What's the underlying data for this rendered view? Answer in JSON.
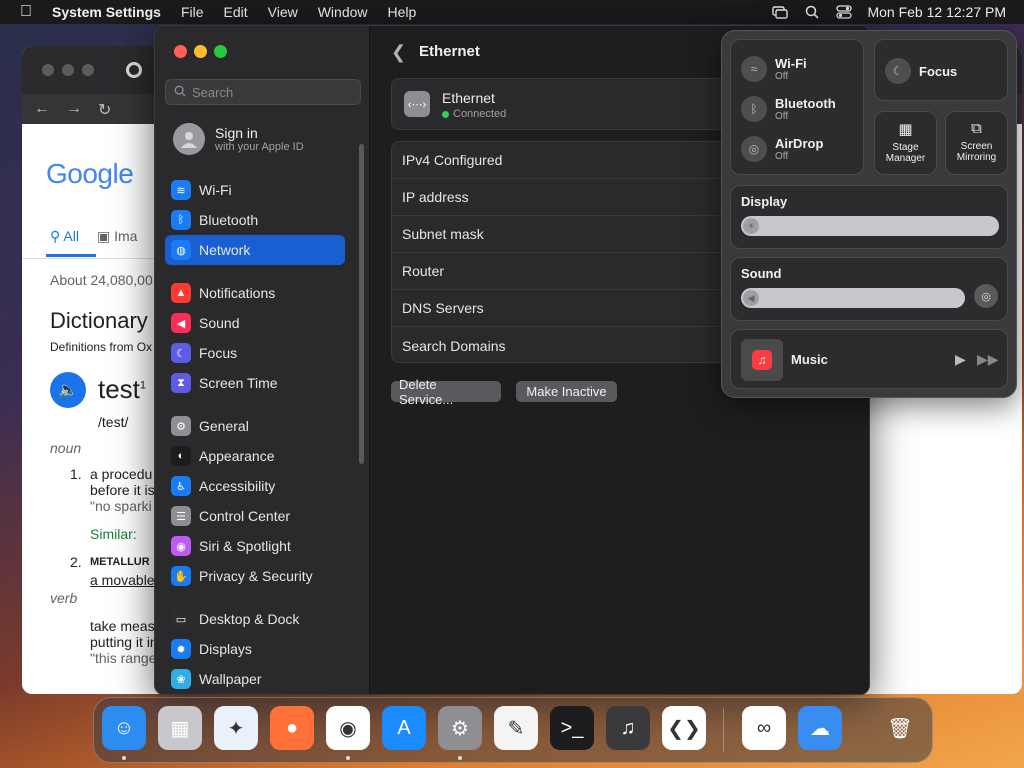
{
  "menubar": {
    "app_name": "System Settings",
    "menus": [
      "File",
      "Edit",
      "View",
      "Window",
      "Help"
    ],
    "datetime": "Mon Feb 12  12:27 PM"
  },
  "browser": {
    "google_logo": "Google",
    "tab_all": "All",
    "tab_images": "Ima",
    "about": "About 24,080,00",
    "dictionary": "Dictionary",
    "definitions_from": "Definitions from Ox",
    "word": "test",
    "word_sup": "1",
    "pronunciation": "/test/",
    "pos_noun": "noun",
    "n1": "1.",
    "def1a": "a procedu",
    "def1b": "before it is",
    "def1c": "\"no sparki",
    "similar": "Similar:",
    "n2": "2.",
    "def2a": "METALLUR",
    "def2b": "a movable",
    "pos_verb": "verb",
    "def3a": "take meas",
    "def3b": "putting it in",
    "def3c": "\"this range"
  },
  "settings": {
    "search_placeholder": "Search",
    "apple_id": {
      "title": "Sign in",
      "subtitle": "with your Apple ID"
    },
    "sidebar": [
      {
        "label": "Wi-Fi",
        "icon": "wifi-icon",
        "color": "#1a7cf5",
        "glyph": "≋"
      },
      {
        "label": "Bluetooth",
        "icon": "bluetooth-icon",
        "color": "#1a7cf5",
        "glyph": "ᛒ"
      },
      {
        "label": "Network",
        "icon": "globe-icon",
        "color": "#1a7cf5",
        "glyph": "◍"
      },
      {
        "label": "Notifications",
        "icon": "bell-icon",
        "color": "#ff3b30",
        "glyph": "▲"
      },
      {
        "label": "Sound",
        "icon": "speaker-icon",
        "color": "#ff2d55",
        "glyph": "◀"
      },
      {
        "label": "Focus",
        "icon": "moon-icon",
        "color": "#5e5ce6",
        "glyph": "☾"
      },
      {
        "label": "Screen Time",
        "icon": "hourglass-icon",
        "color": "#5e5ce6",
        "glyph": "⧗"
      },
      {
        "label": "General",
        "icon": "gear-icon",
        "color": "#8e8e93",
        "glyph": "⚙"
      },
      {
        "label": "Appearance",
        "icon": "appearance-icon",
        "color": "#1c1c1e",
        "glyph": "◐"
      },
      {
        "label": "Accessibility",
        "icon": "accessibility-icon",
        "color": "#1a7cf5",
        "glyph": "♿"
      },
      {
        "label": "Control Center",
        "icon": "control-center-icon",
        "color": "#8e8e93",
        "glyph": "☰"
      },
      {
        "label": "Siri & Spotlight",
        "icon": "siri-icon",
        "color": "#bf5af2",
        "glyph": "◉"
      },
      {
        "label": "Privacy & Security",
        "icon": "hand-icon",
        "color": "#1a7cf5",
        "glyph": "✋"
      },
      {
        "label": "Desktop & Dock",
        "icon": "dock-icon",
        "color": "#2c2c2e",
        "glyph": "▭"
      },
      {
        "label": "Displays",
        "icon": "sun-icon",
        "color": "#1a7cf5",
        "glyph": "✹"
      },
      {
        "label": "Wallpaper",
        "icon": "wallpaper-icon",
        "color": "#32ade6",
        "glyph": "❀"
      }
    ],
    "content": {
      "title": "Ethernet",
      "ethernet_name": "Ethernet",
      "ethernet_status": "Connected",
      "rows": [
        "IPv4 Configured",
        "IP address",
        "Subnet mask",
        "Router",
        "DNS Servers",
        "Search Domains"
      ],
      "delete_button": "Delete Service...",
      "inactive_button": "Make Inactive"
    }
  },
  "control_center": {
    "wifi": {
      "label": "Wi-Fi",
      "state": "Off"
    },
    "bluetooth": {
      "label": "Bluetooth",
      "state": "Off"
    },
    "airdrop": {
      "label": "AirDrop",
      "state": "Off"
    },
    "focus": "Focus",
    "stage_manager": [
      "Stage",
      "Manager"
    ],
    "screen_mirroring": [
      "Screen",
      "Mirroring"
    ],
    "display": "Display",
    "sound": "Sound",
    "music": "Music"
  },
  "dock": [
    {
      "name": "finder",
      "color": "#2d8cf0",
      "glyph": "☺",
      "running": true
    },
    {
      "name": "launchpad",
      "color": "#c8c8cc",
      "glyph": "▦",
      "running": false
    },
    {
      "name": "safari",
      "color": "#e9f1fb",
      "glyph": "✦",
      "running": false
    },
    {
      "name": "firefox",
      "color": "#ff7139",
      "glyph": "●",
      "running": false
    },
    {
      "name": "chrome",
      "color": "#ffffff",
      "glyph": "◉",
      "running": true
    },
    {
      "name": "app-store",
      "color": "#1a8cff",
      "glyph": "A",
      "running": false
    },
    {
      "name": "system-settings",
      "color": "#8e8e93",
      "glyph": "⚙",
      "running": true
    },
    {
      "name": "textedit",
      "color": "#f4f4f4",
      "glyph": "✎",
      "running": false
    },
    {
      "name": "terminal",
      "color": "#1c1c1e",
      "glyph": ">_",
      "running": false
    },
    {
      "name": "garageband",
      "color": "#3a3a3c",
      "glyph": "♫",
      "running": false
    },
    {
      "name": "vscode",
      "color": "#ffffff",
      "glyph": "❮❯",
      "running": false
    },
    {
      "name": "visual-studio",
      "color": "#ffffff",
      "glyph": "∞",
      "running": false
    },
    {
      "name": "weather",
      "color": "#3a8df0",
      "glyph": "☁",
      "running": false
    },
    {
      "name": "trash",
      "color": "rgba(0,0,0,0)",
      "glyph": "🗑",
      "running": false
    }
  ]
}
